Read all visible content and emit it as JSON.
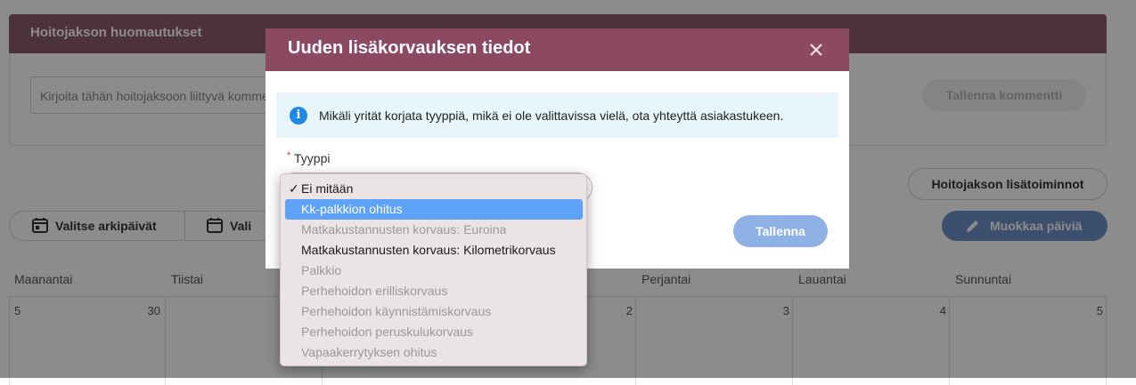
{
  "notes": {
    "title": "Hoitojakson huomautukset",
    "placeholder": "Kirjoita tähän hoitojaksoon liittyvä kommentti",
    "save_label": "Tallenna kommentti"
  },
  "toolbar": {
    "extra_ops_label": "Hoitojakson lisätoiminnot",
    "select_weekdays_label": "Valitse arkipäivät",
    "select_second_label": "Vali",
    "edit_days_label": "Muokkaa päiviä"
  },
  "calendar": {
    "days": [
      "Maanantai",
      "Tiistai",
      "",
      "",
      "Perjantai",
      "Lauantai",
      "Sunnuntai"
    ],
    "first_row": {
      "monday_week": "5",
      "monday_date": "30",
      "thursday_date": "2",
      "friday_date": "3",
      "saturday_date": "4",
      "sunday_date": "5"
    }
  },
  "modal": {
    "title": "Uuden lisäkorvauksen tiedot",
    "info_text": "Mikäli yrität korjata tyyppiä, mikä ei ole valittavissa vielä, ota yhteyttä asiakastukeen.",
    "required_mark": "*",
    "type_label": "Tyyppi",
    "save_label": "Tallenna"
  },
  "dropdown": {
    "check_mark": "✓",
    "options": [
      {
        "label": "Ei mitään",
        "state": "checked"
      },
      {
        "label": "Kk-palkkion ohitus",
        "state": "highlighted"
      },
      {
        "label": "Matkakustannusten korvaus: Euroina",
        "state": "disabled"
      },
      {
        "label": "Matkakustannusten korvaus: Kilometrikorvaus",
        "state": "enabled"
      },
      {
        "label": "Palkkio",
        "state": "disabled"
      },
      {
        "label": "Perhehoidon erilliskorvaus",
        "state": "disabled"
      },
      {
        "label": "Perhehoidon käynnistämiskorvaus",
        "state": "disabled"
      },
      {
        "label": "Perhehoidon peruskulukorvaus",
        "state": "disabled"
      },
      {
        "label": "Vapaakerrytyksen ohitus",
        "state": "disabled"
      }
    ]
  },
  "colors": {
    "header_bg": "#8b4962",
    "accent_blue": "#5ea3f7",
    "info_bg": "#e8f5fb",
    "info_icon": "#1e88e5"
  }
}
